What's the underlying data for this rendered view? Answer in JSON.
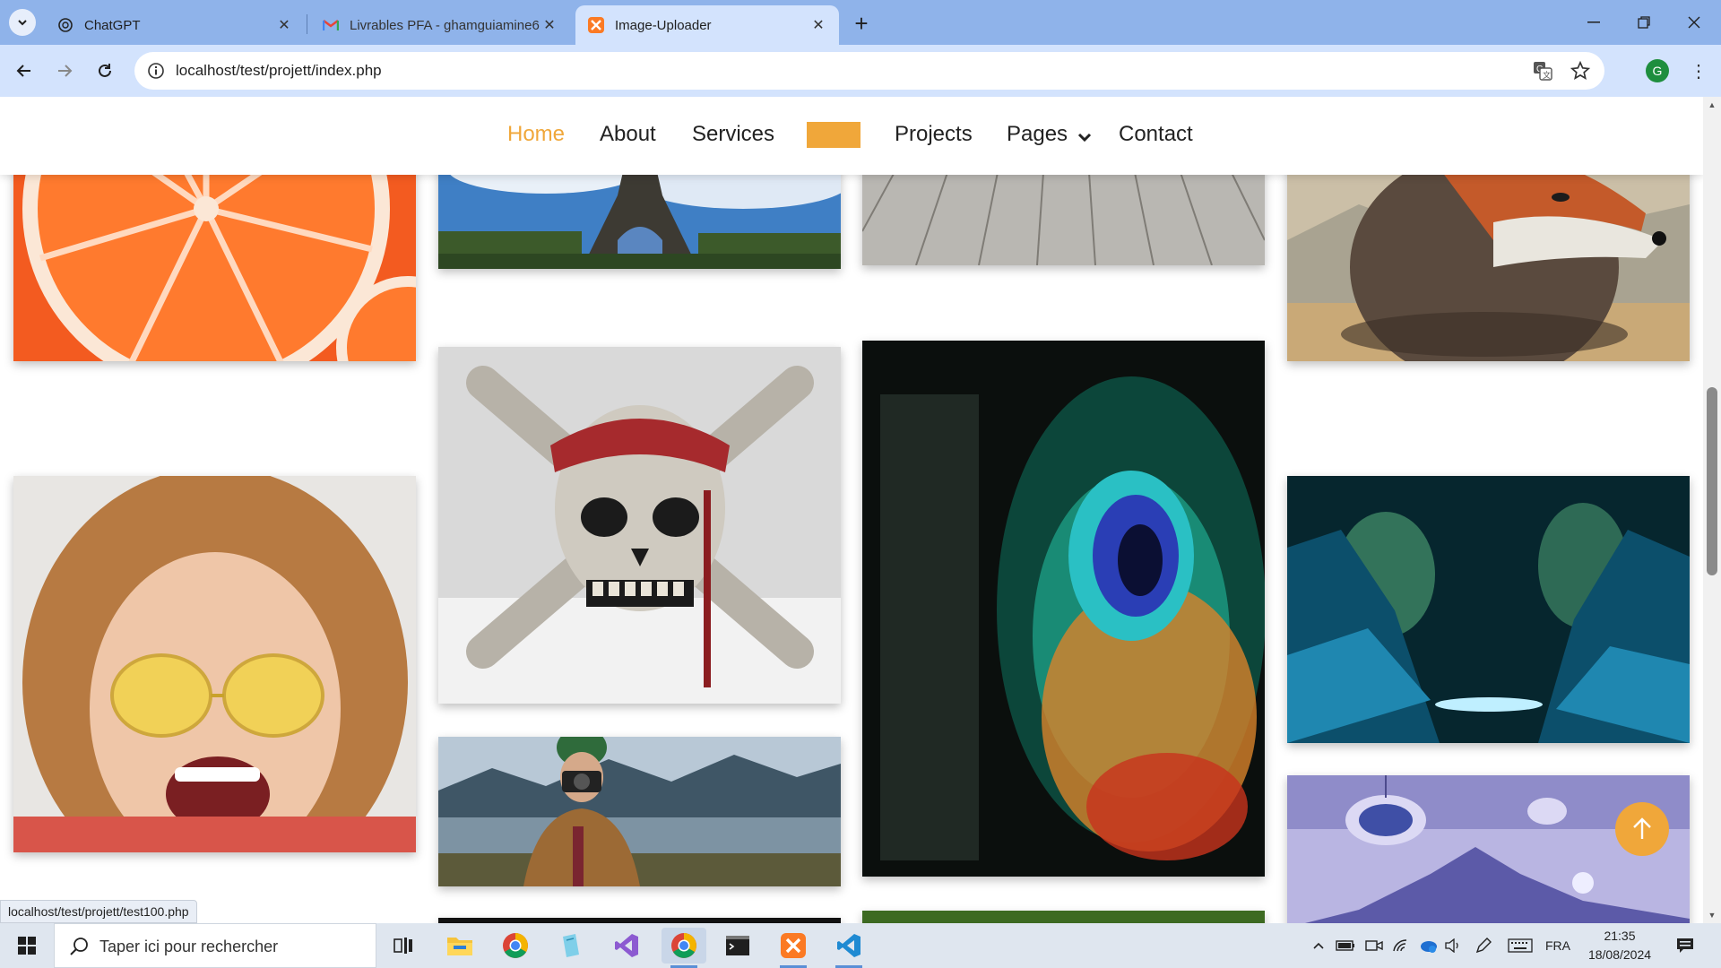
{
  "browser": {
    "tabs": [
      {
        "title": "ChatGPT",
        "icon": "chatgpt-icon"
      },
      {
        "title": "Livrables PFA - ghamguiamine6",
        "icon": "gmail-icon"
      },
      {
        "title": "Image-Uploader",
        "icon": "xampp-icon",
        "active": true
      }
    ],
    "url": "localhost/test/projett/index.php",
    "profile_initial": "G"
  },
  "site": {
    "nav": [
      {
        "label": "Home",
        "active": true
      },
      {
        "label": "About"
      },
      {
        "label": "Services"
      },
      {
        "label": "Projects"
      },
      {
        "label": "Pages"
      },
      {
        "label": "Contact"
      }
    ],
    "accent": "#f0a73a",
    "gallery": [
      {
        "name": "orange-slice-photo"
      },
      {
        "name": "eiffel-tower-photo"
      },
      {
        "name": "wooden-floor-photo"
      },
      {
        "name": "fox-photo"
      },
      {
        "name": "pirate-skull-photo"
      },
      {
        "name": "peacock-feather-photo"
      },
      {
        "name": "smiling-woman-photo"
      },
      {
        "name": "night-mountains-photo"
      },
      {
        "name": "photographer-photo"
      },
      {
        "name": "surreal-jellyfish-photo"
      }
    ],
    "status_url": "localhost/test/projett/test100.php"
  },
  "taskbar": {
    "search_placeholder": "Taper ici pour rechercher",
    "language": "FRA",
    "time": "21:35",
    "date": "18/08/2024"
  }
}
